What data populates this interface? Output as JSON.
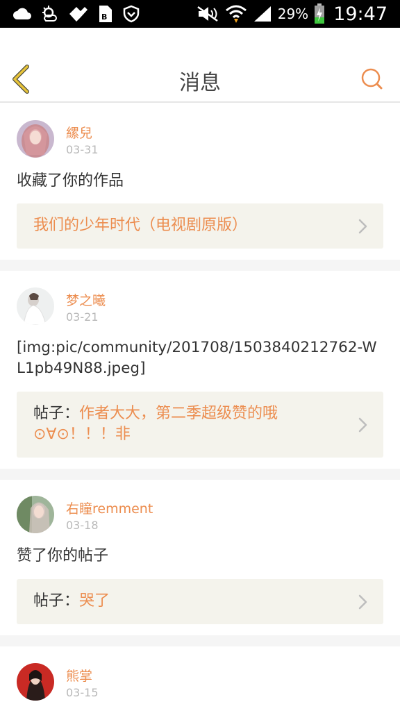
{
  "status_bar": {
    "battery_percent": "29%",
    "time": "19:47",
    "icons": [
      "cloud-icon",
      "weather-icon",
      "puzzle-icon",
      "sim-icon",
      "shield-icon",
      "mute-icon",
      "wifi-icon",
      "signal-icon",
      "battery-icon"
    ]
  },
  "header": {
    "title": "消息",
    "back_icon": "chevron-left-icon",
    "search_icon": "search-icon",
    "accent_color": "#ec8d4f",
    "back_color": "#e8c43a"
  },
  "messages": [
    {
      "username": "縲兒",
      "date": "03-31",
      "text": "收藏了你的作品",
      "ref_prefix": "",
      "ref_text": "我们的少年时代（电视剧原版）"
    },
    {
      "username": "梦之曦",
      "date": "03-21",
      "text": "[img:pic/community/201708/1503840212762-WL1pb49N88.jpeg]",
      "ref_prefix": "帖子：",
      "ref_text": "作者大大，第二季超级赞的哦⊙∀⊙！！！非"
    },
    {
      "username": "右瞳remment",
      "date": "03-18",
      "text": "赞了你的帖子",
      "ref_prefix": "帖子：",
      "ref_text": "哭了"
    },
    {
      "username": "熊掌",
      "date": "03-15",
      "text": "",
      "ref_prefix": "",
      "ref_text": ""
    }
  ]
}
